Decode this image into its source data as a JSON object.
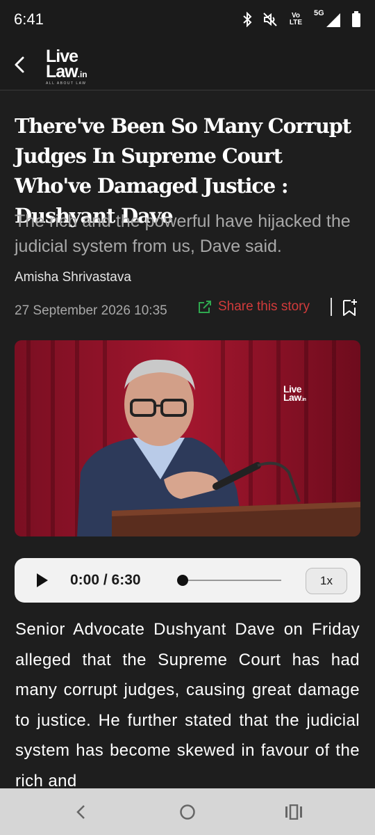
{
  "status_bar": {
    "time": "6:41",
    "net_label": "Vo LTE",
    "signal_label": "5G"
  },
  "header": {
    "logo_line1": "Live",
    "logo_line2": "Law",
    "logo_suffix": ".in",
    "logo_tagline": "ALL ABOUT LAW"
  },
  "article": {
    "headline": "There've Been So Many Corrupt Judges In Supreme Court Who've Damaged Justice : Dushyant Dave",
    "subhead": "The rich and the powerful have hijacked the judicial system from us, Dave said.",
    "author": "Amisha Shrivastava",
    "date": "27 September 2026 10:35",
    "share_label": "Share this story",
    "image_watermark_line1": "Live",
    "image_watermark_line2": "Law",
    "image_watermark_suffix": ".in",
    "body": "Senior Advocate Dushyant Dave on Friday alleged that the Supreme Court has had many corrupt judges, causing great damage to justice. He further stated that the judicial system has become skewed in favour of the rich and"
  },
  "player": {
    "time": "0:00 / 6:30",
    "speed": "1x",
    "progress": 0
  },
  "colors": {
    "accent_share": "#d13b3b",
    "share_icon": "#2fa84f",
    "background": "#1e1e1e",
    "nav_bar": "#d6d6d6"
  },
  "icons": [
    "bluetooth-icon",
    "mute-icon",
    "volte-icon",
    "signal-icon",
    "battery-icon",
    "back-arrow-icon",
    "share-icon",
    "bookmark-icon",
    "play-icon",
    "nav-back-icon",
    "nav-home-icon",
    "nav-recents-icon"
  ]
}
